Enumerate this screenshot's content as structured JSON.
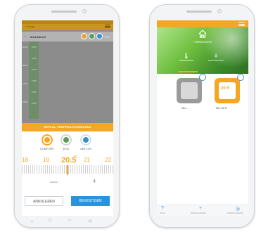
{
  "left_phone": {
    "header_title": "< Terug",
    "day_name": "MAANDAG",
    "day_temp": "17.5°",
    "time_labels": [
      "00:00",
      "06:00",
      "12:00",
      "18:00"
    ],
    "bar_cells": [
      "17.5°",
      "17.5°",
      "17.5°",
      "17.5°",
      "17.5°",
      "17.5°"
    ],
    "banner_text": "BEPAAL TEMPERATUURNIVEAU",
    "modes": [
      {
        "label": "COMFORT"
      },
      {
        "label": "ECO"
      },
      {
        "label": "ANTI-VS"
      }
    ],
    "temp_scale": [
      "18",
      "19",
      "21",
      "22"
    ],
    "current_temp": "20.5",
    "temp_unit": "°C",
    "minus_label": "—",
    "plus_label": "+",
    "cancel_label": "ANNULEREN",
    "confirm_label": "BEVESTIGEN",
    "nav_icons": [
      "chevron-down-icon",
      "square-icon",
      "circle-icon",
      "triangle-back-icon"
    ],
    "nav_glyphs": [
      "⌄",
      "□",
      "○",
      "◁"
    ]
  },
  "right_phone": {
    "subtitle": "THERMOSTAT",
    "tabs": [
      "VERWARMING",
      "ELEKTRICITEIT"
    ],
    "tab_glyphs": [
      "🌡",
      "⏚"
    ],
    "devices": [
      {
        "label": "NU --",
        "state": "off",
        "temp": ""
      },
      {
        "label": "NU 19.4°",
        "state": "on",
        "temp": "20.5"
      }
    ],
    "bottom_nav": [
      {
        "icon": "?",
        "label": "HULP"
      },
      {
        "icon": "+",
        "label": "INSTELLINGEN"
      },
      {
        "icon": "◎",
        "label": "CONFIGURATIE"
      }
    ]
  },
  "colors": {
    "accent": "#f5a623",
    "accent_dark": "#c8961c",
    "eco": "#5f9b5c",
    "anti": "#3a90c9",
    "confirm": "#2b93d9"
  }
}
